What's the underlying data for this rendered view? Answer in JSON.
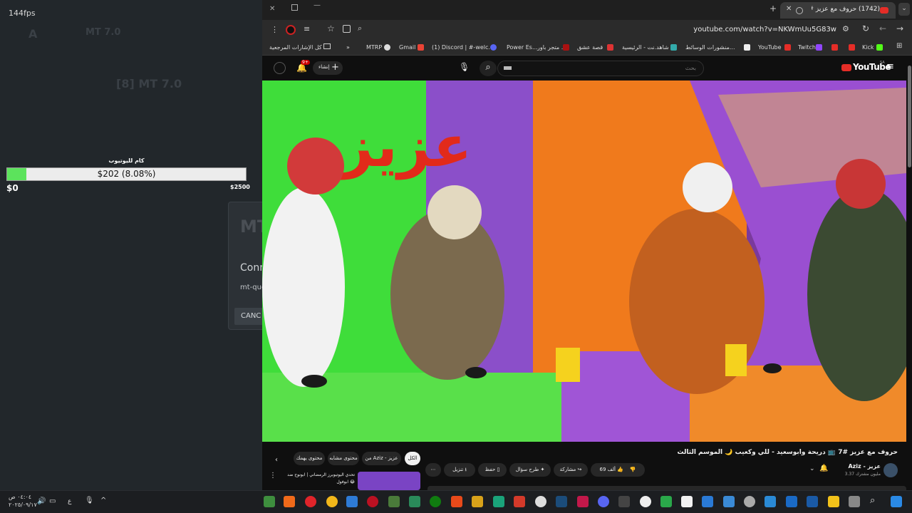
{
  "overlay": {
    "fps": "144fps",
    "ghost_title_1": "MT 7.0",
    "ghost_title_2": "[8] MT 7.0",
    "progress": {
      "label": "كام لليوتيوب",
      "text": "$202 (8.08%)",
      "fraction": 0.0808,
      "min": "$0",
      "max": "$2500",
      "fill_color": "#5ce35c"
    },
    "dialog": {
      "logo": "MTR",
      "title": "Conn",
      "subtitle": "mt-que",
      "button": "CANC"
    }
  },
  "browser": {
    "tab": {
      "title": "(1742) حروف مع عزيز #7",
      "close": "✕"
    },
    "new_tab": "+",
    "url": "youtube.com/watch?v=NKWmUu5G83w",
    "bookmarks": [
      "Kick",
      "",
      "Twitch",
      "YouTube",
      "منشورات الوسائط...",
      "شاهد.نت - الرئيسية",
      "قصة عشق",
      "متجر باور ...",
      "Power Es...",
      "(1) Discord | #-welc...",
      "Gmail",
      "MTRP"
    ],
    "bookmarks_more": "»",
    "all_bookmarks": "كل الإشارات المرجعية"
  },
  "youtube": {
    "logo": "YouTube",
    "logo_sup": "SA",
    "search_placeholder": "بحث",
    "create_label": "إنشاء",
    "notif_count": "9+",
    "video_title": "حروف مع عزيز #7 📺 دريحة وابوسعيد - للي وكعيب 🌙 الموسم الثالث",
    "channel": "Aziz - عزيز",
    "subscribers": "3.37 مليون مشترك",
    "likes": "69 ألف",
    "actions": [
      "مشاركة",
      "طرح سؤال",
      "حفظ",
      "تنزيل"
    ],
    "more": "⋯",
    "chips": [
      "الكل",
      "من Aziz - عزيز",
      "محتوى مشابه",
      "محتوى يهمك"
    ],
    "rec_title": "تحدي اليوتيوبرز الرمضاني | ابونوح ضد ابوفول 😂",
    "rec_channel": ""
  },
  "taskbar": {
    "time": "٠٤:٠٤ ص",
    "date": "٢٠٢٥/٠٩/١٧",
    "lang": "ع"
  }
}
